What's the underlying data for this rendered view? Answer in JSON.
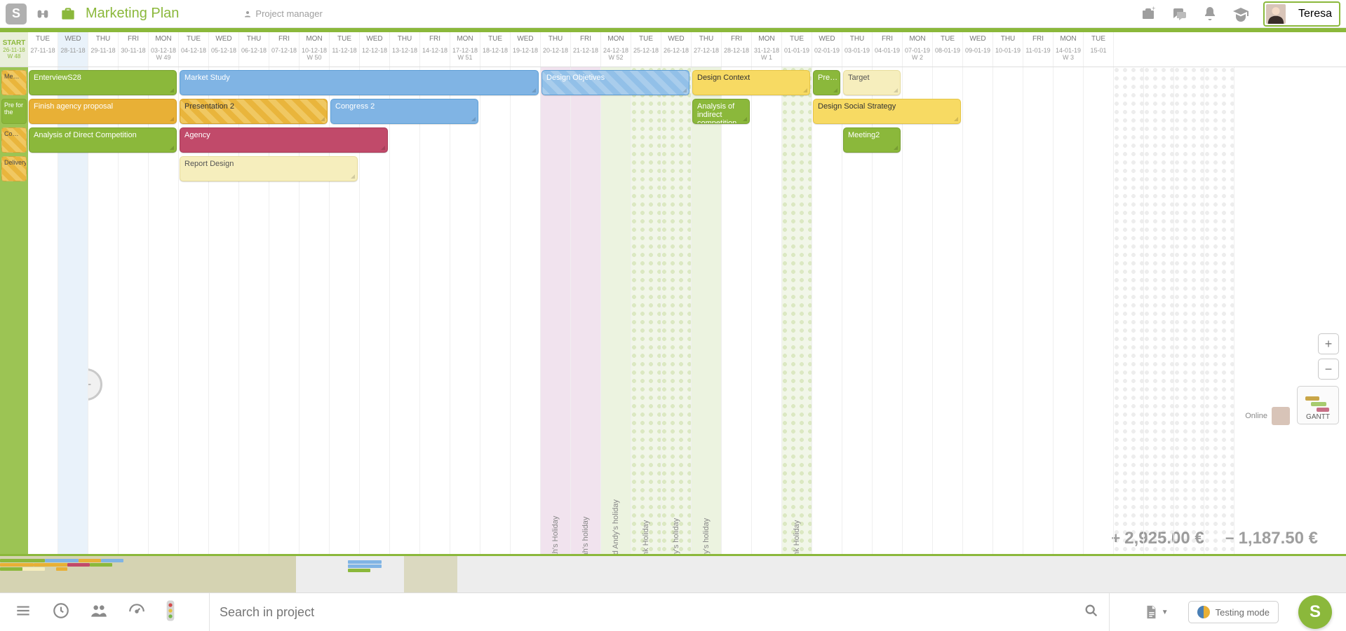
{
  "header": {
    "title": "Marketing Plan",
    "role": "Project manager",
    "user_name": "Teresa"
  },
  "timeline": {
    "start_label": "START",
    "start_date": "26-11-18",
    "start_week": "W 48",
    "days": [
      {
        "dow": "TUE",
        "date": "27-11-18"
      },
      {
        "dow": "WED",
        "date": "28-11-18",
        "today": true
      },
      {
        "dow": "THU",
        "date": "29-11-18"
      },
      {
        "dow": "FRI",
        "date": "30-11-18"
      },
      {
        "dow": "MON",
        "date": "03-12-18",
        "week": "W 49"
      },
      {
        "dow": "TUE",
        "date": "04-12-18"
      },
      {
        "dow": "WED",
        "date": "05-12-18"
      },
      {
        "dow": "THU",
        "date": "06-12-18"
      },
      {
        "dow": "FRI",
        "date": "07-12-18"
      },
      {
        "dow": "MON",
        "date": "10-12-18",
        "week": "W 50"
      },
      {
        "dow": "TUE",
        "date": "11-12-18"
      },
      {
        "dow": "WED",
        "date": "12-12-18"
      },
      {
        "dow": "THU",
        "date": "13-12-18"
      },
      {
        "dow": "FRI",
        "date": "14-12-18"
      },
      {
        "dow": "MON",
        "date": "17-12-18",
        "week": "W 51"
      },
      {
        "dow": "TUE",
        "date": "18-12-18"
      },
      {
        "dow": "WED",
        "date": "19-12-18"
      },
      {
        "dow": "THU",
        "date": "20-12-18",
        "pink": true,
        "vlabel": "Sarah's Holiday"
      },
      {
        "dow": "FRI",
        "date": "21-12-18",
        "pink": true,
        "vlabel": "Sarah's holiday"
      },
      {
        "dow": "MON",
        "date": "24-12-18",
        "week": "W 52",
        "ltgreen": true,
        "vlabel": "Sarah and Andy's holiday"
      },
      {
        "dow": "TUE",
        "date": "25-12-18",
        "hatchgreen": true,
        "vlabel": "Bank Holiday"
      },
      {
        "dow": "WED",
        "date": "26-12-18",
        "hatchgreen": true,
        "vlabel": "Andy's holiday"
      },
      {
        "dow": "THU",
        "date": "27-12-18",
        "ltgreen": true,
        "vlabel": "Andy's holiday"
      },
      {
        "dow": "FRI",
        "date": "28-12-18"
      },
      {
        "dow": "MON",
        "date": "31-12-18",
        "week": "W 1"
      },
      {
        "dow": "TUE",
        "date": "01-01-19",
        "hatchgreen": true,
        "vlabel": "Bank Holiday"
      },
      {
        "dow": "WED",
        "date": "02-01-19"
      },
      {
        "dow": "THU",
        "date": "03-01-19"
      },
      {
        "dow": "FRI",
        "date": "04-01-19"
      },
      {
        "dow": "MON",
        "date": "07-01-19",
        "week": "W 2"
      },
      {
        "dow": "TUE",
        "date": "08-01-19"
      },
      {
        "dow": "WED",
        "date": "09-01-19"
      },
      {
        "dow": "THU",
        "date": "10-01-19"
      },
      {
        "dow": "FRI",
        "date": "11-01-19"
      },
      {
        "dow": "MON",
        "date": "14-01-19",
        "week": "W 3"
      },
      {
        "dow": "TUE",
        "date": "15-01"
      }
    ]
  },
  "pre_tasks": [
    {
      "row": 0,
      "label": "Me…",
      "cls": "amber-hatch"
    },
    {
      "row": 1,
      "label": "Pre for the",
      "cls": "green"
    },
    {
      "row": 2,
      "label": "Co…",
      "cls": "amber-hatch"
    },
    {
      "row": 3,
      "label": "Delivery",
      "cls": "amber-hatch"
    }
  ],
  "tasks": [
    {
      "row": 0,
      "start": 0,
      "span": 5,
      "label": "EnterviewS28",
      "cls": "green"
    },
    {
      "row": 0,
      "start": 5,
      "span": 12,
      "label": "Market Study",
      "cls": "blue"
    },
    {
      "row": 0,
      "start": 17,
      "span": 5,
      "label": "Design Objetives",
      "cls": "blue-hatch"
    },
    {
      "row": 0,
      "start": 22,
      "span": 4,
      "label": "Design Context",
      "cls": "yellow"
    },
    {
      "row": 0,
      "start": 26,
      "span": 1,
      "label": "Pre…",
      "cls": "green"
    },
    {
      "row": 0,
      "start": 27,
      "span": 2,
      "label": "Target",
      "cls": "cream"
    },
    {
      "row": 1,
      "start": 0,
      "span": 5,
      "label": "Finish agency proposal",
      "cls": "amber"
    },
    {
      "row": 1,
      "start": 5,
      "span": 5,
      "label": "Presentation 2",
      "cls": "amber-hatch"
    },
    {
      "row": 1,
      "start": 10,
      "span": 5,
      "label": "Congress 2",
      "cls": "blue"
    },
    {
      "row": 1,
      "start": 22,
      "span": 2,
      "label": "Analysis of indirect competition",
      "cls": "green"
    },
    {
      "row": 1,
      "start": 26,
      "span": 5,
      "label": "Design Social Strategy",
      "cls": "yellow"
    },
    {
      "row": 2,
      "start": 0,
      "span": 5,
      "label": "Analysis of Direct Competition",
      "cls": "green"
    },
    {
      "row": 2,
      "start": 5,
      "span": 7,
      "label": "Agency",
      "cls": "rose"
    },
    {
      "row": 2,
      "start": 27,
      "span": 2,
      "label": "Meeting2",
      "cls": "green"
    },
    {
      "row": 3,
      "start": 5,
      "span": 6,
      "label": "Report Design",
      "cls": "cream"
    }
  ],
  "money": {
    "positive": "2,925.00 €",
    "negative": "1,187.50 €"
  },
  "sidebar": {
    "online_label": "Online",
    "gantt_label": "GANTT"
  },
  "footer": {
    "search_placeholder": "Search in project",
    "testing_label": "Testing mode"
  }
}
